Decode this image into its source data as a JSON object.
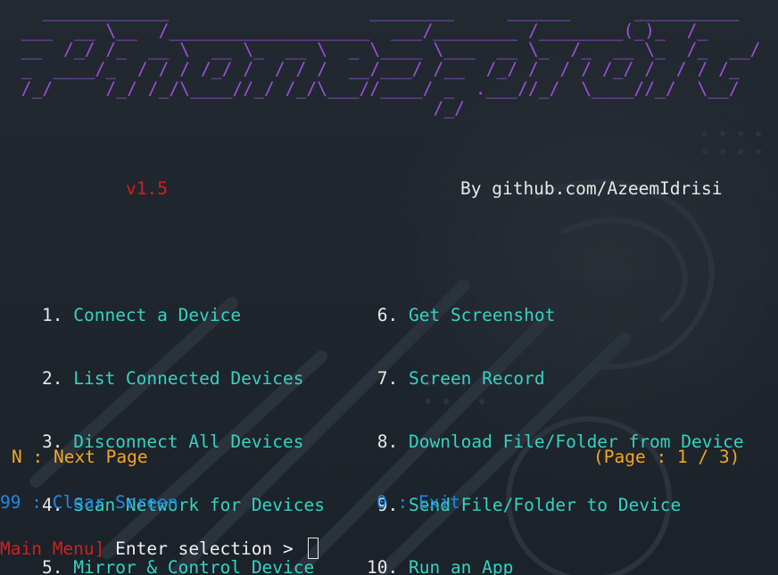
{
  "banner": {
    "ascii": "    ____________                   ________     ______      __________\n  ___  __ \\__  /___________________  ___/________ /________(_)_  /_\n  __  /_/ /_  __ \\  __ \\_  __ \\  _ \\____ \\___  __ \\_  /_  __ \\_  /_  __/\n  _  ____/_  / / / /_/ /  / / /  __/___/ /__  /_/ /  / / /_/ /  / / /_\n  /_/     /_/ /_/\\____//_/ /_/\\___//____/ _  .___//_/  \\____//_/  \\__/\n                                         /_/",
    "version": "v1.5",
    "author": "By github.com/AzeemIdrisi"
  },
  "menu": {
    "left": [
      {
        "num": "1.",
        "label": "Connect a Device"
      },
      {
        "num": "2.",
        "label": "List Connected Devices"
      },
      {
        "num": "3.",
        "label": "Disconnect All Devices"
      },
      {
        "num": "4.",
        "label": "Scan Network for Devices"
      },
      {
        "num": "5.",
        "label": "Mirror & Control Device"
      }
    ],
    "right": [
      {
        "num": " 6.",
        "label": "Get Screenshot"
      },
      {
        "num": " 7.",
        "label": "Screen Record"
      },
      {
        "num": " 8.",
        "label": "Download File/Folder from Device"
      },
      {
        "num": " 9.",
        "label": "Send File/Folder to Device"
      },
      {
        "num": "10.",
        "label": "Run an App"
      }
    ]
  },
  "footer": {
    "next_page": "N : Next Page",
    "page_indicator": "(Page : 1 / 3)",
    "clear_screen": "99 : Clear Screen",
    "exit": "0 : Exit"
  },
  "prompt": {
    "context": "Main Menu]",
    "text": "Enter selection >"
  },
  "colors": {
    "background": "#1f252d",
    "banner": "#9d4edd",
    "menu_label": "#34d3c4",
    "highlight_red": "#d21f1f",
    "orange": "#f5a623",
    "blue": "#1e88e5"
  }
}
